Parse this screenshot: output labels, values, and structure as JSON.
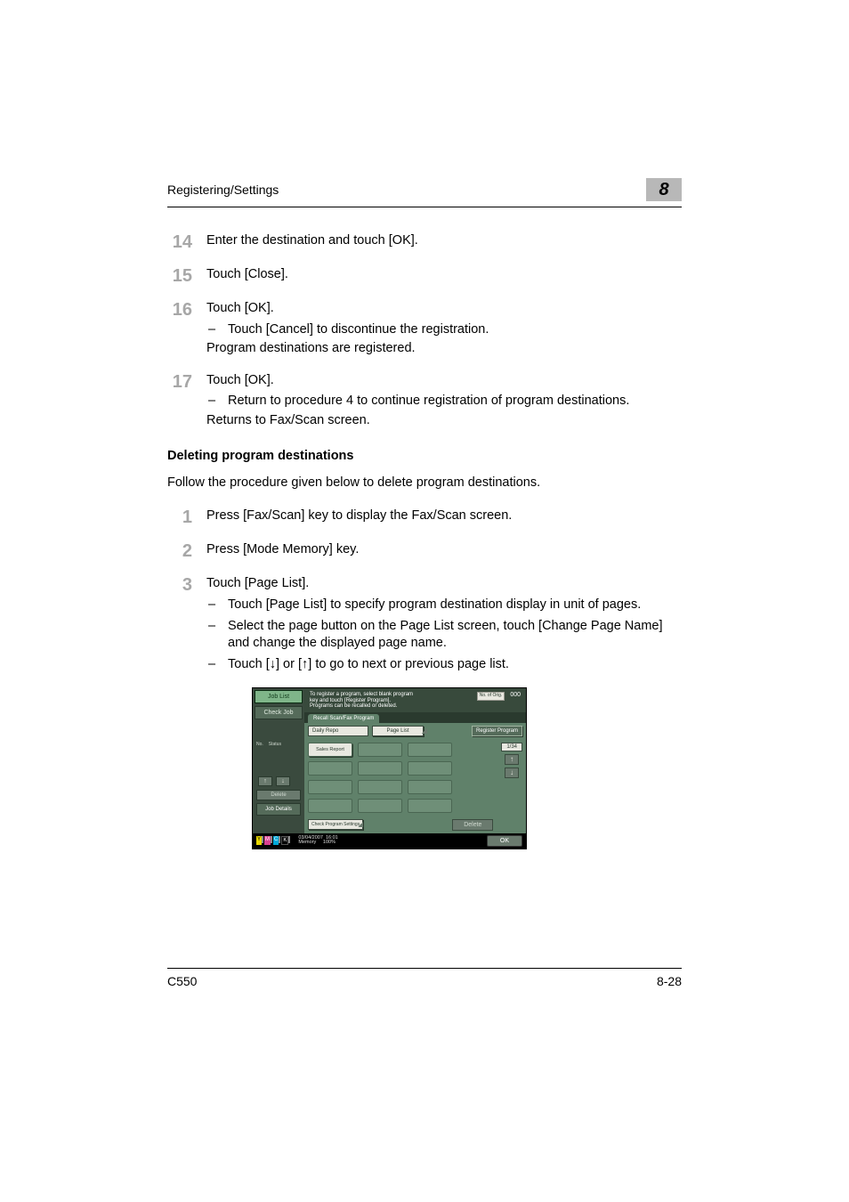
{
  "header": {
    "title": "Registering/Settings",
    "chapter": "8"
  },
  "steps_a": [
    {
      "num": "14",
      "text": "Enter the destination and touch [OK].",
      "subs": []
    },
    {
      "num": "15",
      "text": "Touch [Close].",
      "subs": []
    },
    {
      "num": "16",
      "text": "Touch [OK].",
      "subs": [
        {
          "dash": "–",
          "text": "Touch [Cancel] to discontinue the registration."
        }
      ],
      "note": "Program destinations are registered."
    },
    {
      "num": "17",
      "text": "Touch [OK].",
      "subs": [
        {
          "dash": "–",
          "text": "Return to procedure 4 to continue registration of program destinations."
        }
      ],
      "note": "Returns to Fax/Scan screen."
    }
  ],
  "section": {
    "title": "Deleting program destinations",
    "intro": "Follow the procedure given below to delete program destinations."
  },
  "steps_b": [
    {
      "num": "1",
      "text": "Press [Fax/Scan] key to display the Fax/Scan screen.",
      "subs": []
    },
    {
      "num": "2",
      "text": "Press [Mode Memory] key.",
      "subs": []
    },
    {
      "num": "3",
      "text": "Touch [Page List].",
      "subs": [
        {
          "dash": "–",
          "text": "Touch [Page List] to specify program destination display in unit of pages."
        },
        {
          "dash": "–",
          "text": "Select the page button on the Page List screen, touch [Change Page Name] and change the displayed page name."
        },
        {
          "dash": "–",
          "text": "Touch [↓] or [↑] to go to next or previous page list."
        }
      ]
    }
  ],
  "screenshot": {
    "left": {
      "job_list": "Job List",
      "check_job": "Check Job",
      "hdr1": "No.",
      "hdr2": "Status",
      "delete": "Delete",
      "job_details": "Job Details"
    },
    "msg": {
      "line1": "To register a program, select blank program",
      "line2": "key and touch [Register Program].",
      "line3": "Programs can be recalled or deleted.",
      "icon_label": "No. of\nOrig.",
      "counter": "000"
    },
    "tab": "Recall Scan/Fax Program",
    "toolbar": {
      "field": "Daily Repo",
      "page_list": "Page List",
      "register": "Register Program"
    },
    "grid": {
      "slot1": "Sales Report"
    },
    "pager": "1/34",
    "bottom": {
      "check": "Check Program\nSettings",
      "delete": "Delete"
    },
    "status": {
      "date": "03/04/2007",
      "time": "16:01",
      "memory_label": "Memory",
      "memory_pct": "100%",
      "ok": "OK"
    }
  },
  "footer": {
    "model": "C550",
    "page": "8-28"
  }
}
